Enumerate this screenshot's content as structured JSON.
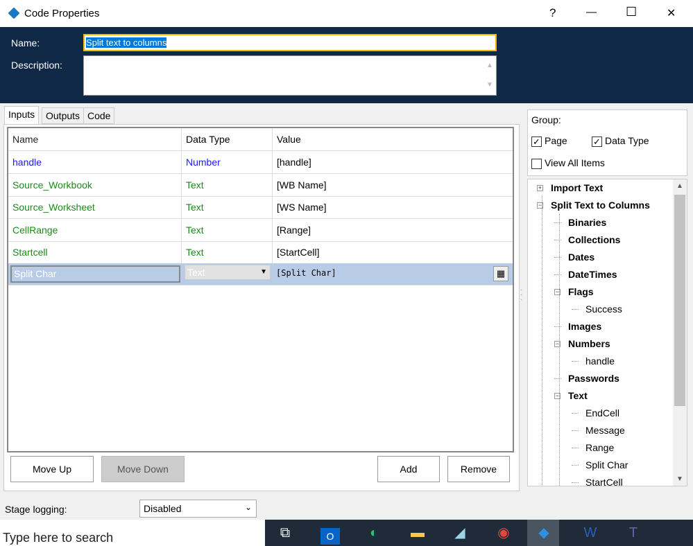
{
  "window": {
    "title": "Code Properties",
    "help": "?",
    "minimize": "—",
    "maximize": "☐",
    "close": "✕"
  },
  "header": {
    "name_label": "Name:",
    "name_value": "Split text to columns",
    "description_label": "Description:",
    "description_value": ""
  },
  "tabs": [
    {
      "label": "Inputs",
      "active": true
    },
    {
      "label": "Outputs"
    },
    {
      "label": "Code"
    }
  ],
  "grid": {
    "columns": [
      "Name",
      "Data Type",
      "Value"
    ],
    "rows": [
      {
        "name": "handle",
        "type": "Number",
        "value": "[handle]",
        "color": "#1a1aff"
      },
      {
        "name": "Source_Workbook",
        "type": "Text",
        "value": "[WB Name]",
        "color": "#1a8a1a"
      },
      {
        "name": "Source_Worksheet",
        "type": "Text",
        "value": "[WS Name]",
        "color": "#1a8a1a"
      },
      {
        "name": "CellRange",
        "type": "Text",
        "value": "[Range]",
        "color": "#1a8a1a"
      },
      {
        "name": "Startcell",
        "type": "Text",
        "value": "[StartCell]",
        "color": "#1a8a1a"
      }
    ],
    "edit_row": {
      "name": "Split Char",
      "type": "Text",
      "value": "[Split Char]"
    }
  },
  "buttons": {
    "move_up": "Move Up",
    "move_down": "Move Down",
    "add": "Add",
    "remove": "Remove"
  },
  "group": {
    "label": "Group:",
    "page": "Page",
    "data_type": "Data Type",
    "view_all": "View All Items",
    "page_checked": true,
    "data_type_checked": true,
    "view_all_checked": false
  },
  "tree": [
    {
      "label": "Import Text",
      "level": 0,
      "bold": true,
      "toggle": "+"
    },
    {
      "label": "Split Text to Columns",
      "level": 0,
      "bold": true,
      "toggle": "-"
    },
    {
      "label": "Binaries",
      "level": 1,
      "bold": true
    },
    {
      "label": "Collections",
      "level": 1,
      "bold": true
    },
    {
      "label": "Dates",
      "level": 1,
      "bold": true
    },
    {
      "label": "DateTimes",
      "level": 1,
      "bold": true
    },
    {
      "label": "Flags",
      "level": 1,
      "bold": true,
      "toggle": "-"
    },
    {
      "label": "Success",
      "level": 2
    },
    {
      "label": "Images",
      "level": 1,
      "bold": true
    },
    {
      "label": "Numbers",
      "level": 1,
      "bold": true,
      "toggle": "-"
    },
    {
      "label": "handle",
      "level": 2
    },
    {
      "label": "Passwords",
      "level": 1,
      "bold": true
    },
    {
      "label": "Text",
      "level": 1,
      "bold": true,
      "toggle": "-"
    },
    {
      "label": "EndCell",
      "level": 2
    },
    {
      "label": "Message",
      "level": 2
    },
    {
      "label": "Range",
      "level": 2
    },
    {
      "label": "Split Char",
      "level": 2
    },
    {
      "label": "StartCell",
      "level": 2
    }
  ],
  "stage_logging": {
    "label": "Stage logging:",
    "value": "Disabled"
  },
  "taskbar": {
    "search_placeholder": "Type here to search"
  }
}
